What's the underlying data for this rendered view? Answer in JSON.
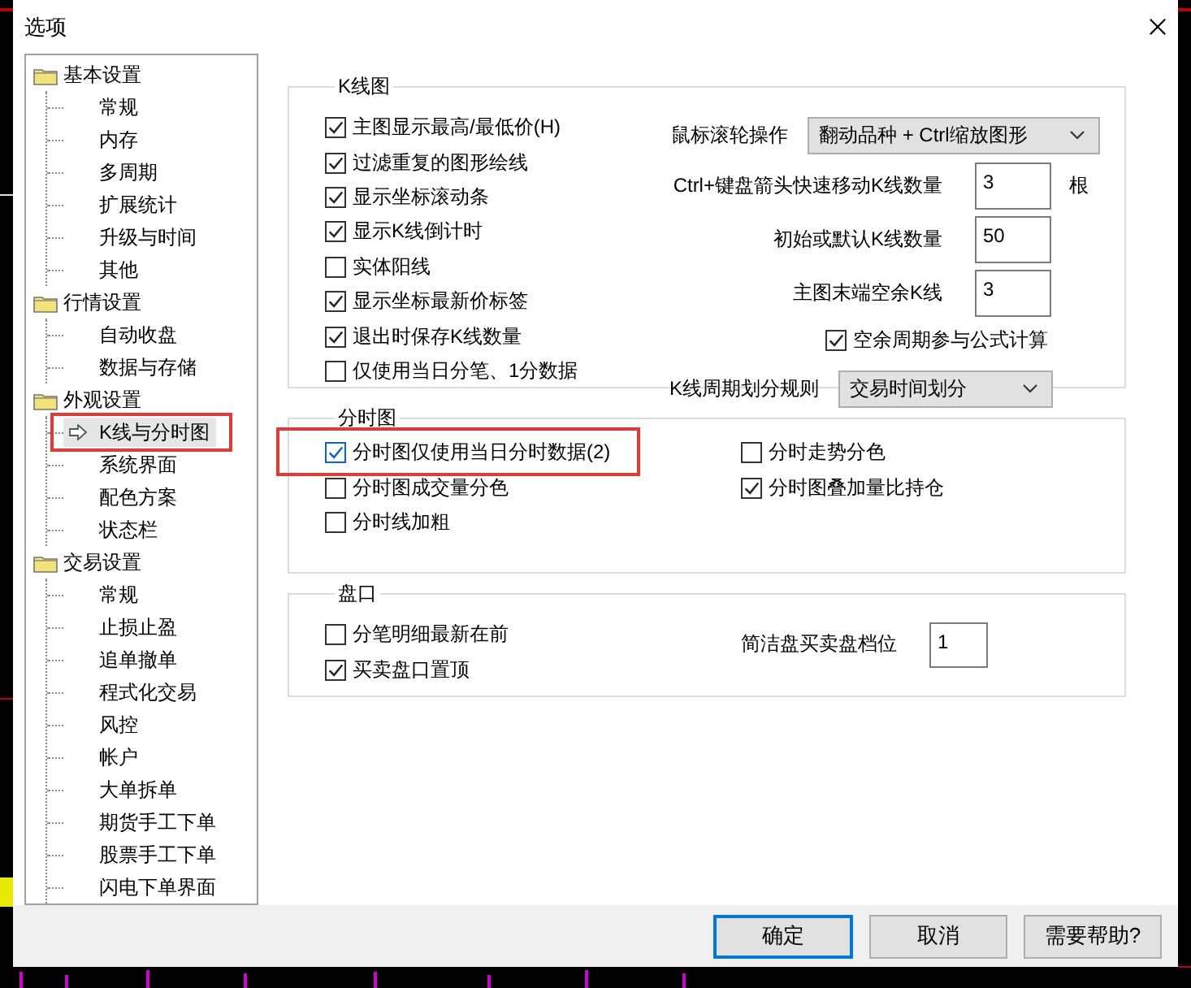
{
  "window": {
    "title": "选项"
  },
  "tree": [
    {
      "label": "基本设置",
      "children": [
        {
          "label": "常规",
          "selected": false
        },
        {
          "label": "内存",
          "selected": false
        },
        {
          "label": "多周期",
          "selected": false
        },
        {
          "label": "扩展统计",
          "selected": false
        },
        {
          "label": "升级与时间",
          "selected": false
        },
        {
          "label": "其他",
          "selected": false
        }
      ]
    },
    {
      "label": "行情设置",
      "children": [
        {
          "label": "自动收盘",
          "selected": false
        },
        {
          "label": "数据与存储",
          "selected": false
        }
      ]
    },
    {
      "label": "外观设置",
      "children": [
        {
          "label": "K线与分时图",
          "selected": true,
          "highlighted": true
        },
        {
          "label": "系统界面",
          "selected": false
        },
        {
          "label": "配色方案",
          "selected": false
        },
        {
          "label": "状态栏",
          "selected": false
        }
      ]
    },
    {
      "label": "交易设置",
      "children": [
        {
          "label": "常规",
          "selected": false
        },
        {
          "label": "止损止盈",
          "selected": false
        },
        {
          "label": "追单撤单",
          "selected": false
        },
        {
          "label": "程式化交易",
          "selected": false
        },
        {
          "label": "风控",
          "selected": false
        },
        {
          "label": "帐户",
          "selected": false
        },
        {
          "label": "大单拆单",
          "selected": false
        },
        {
          "label": "期货手工下单",
          "selected": false
        },
        {
          "label": "股票手工下单",
          "selected": false
        },
        {
          "label": "闪电下单界面",
          "selected": false
        }
      ]
    }
  ],
  "kline": {
    "title": "K线图",
    "options": [
      {
        "label": "主图显示最高/最低价(H)",
        "checked": true
      },
      {
        "label": "过滤重复的图形绘线",
        "checked": true
      },
      {
        "label": "显示坐标滚动条",
        "checked": true
      },
      {
        "label": "显示K线倒计时",
        "checked": true
      },
      {
        "label": "实体阳线",
        "checked": false
      },
      {
        "label": "显示坐标最新价标签",
        "checked": true
      },
      {
        "label": "退出时保存K线数量",
        "checked": true
      },
      {
        "label": "仅使用当日分笔、1分数据",
        "checked": false
      }
    ],
    "settings": [
      {
        "kind": "dropdown",
        "label": "鼠标滚轮操作",
        "value": "翻动品种 + Ctrl缩放图形"
      },
      {
        "kind": "number",
        "label": "Ctrl+键盘箭头快速移动K线数量",
        "value": "3",
        "unit": "根"
      },
      {
        "kind": "number",
        "label": "初始或默认K线数量",
        "value": "50"
      },
      {
        "kind": "number",
        "label": "主图末端空余K线",
        "value": "3"
      },
      {
        "kind": "checkbox",
        "label": "空余周期参与公式计算",
        "checked": true
      },
      {
        "kind": "dropdown",
        "label": "K线周期划分规则",
        "value": "交易时间划分"
      }
    ]
  },
  "timeshare": {
    "title": "分时图",
    "left": [
      {
        "label": "分时图仅使用当日分时数据(2)",
        "checked": true,
        "focused": true,
        "highlighted": true
      },
      {
        "label": "分时图成交量分色",
        "checked": false
      },
      {
        "label": "分时线加粗",
        "checked": false
      }
    ],
    "right": [
      {
        "label": "分时走势分色",
        "checked": false
      },
      {
        "label": "分时图叠加量比持仓",
        "checked": true
      }
    ]
  },
  "orderbook": {
    "title": "盘口",
    "options": [
      {
        "label": "分笔明细最新在前",
        "checked": false
      },
      {
        "label": "买卖盘口置顶",
        "checked": true
      }
    ],
    "settings": [
      {
        "kind": "number",
        "label": "简洁盘买卖盘档位",
        "value": "1"
      }
    ]
  },
  "buttons": [
    {
      "label": "确定",
      "default": true
    },
    {
      "label": "取消",
      "default": false
    },
    {
      "label": "需要帮助?",
      "default": false
    }
  ]
}
